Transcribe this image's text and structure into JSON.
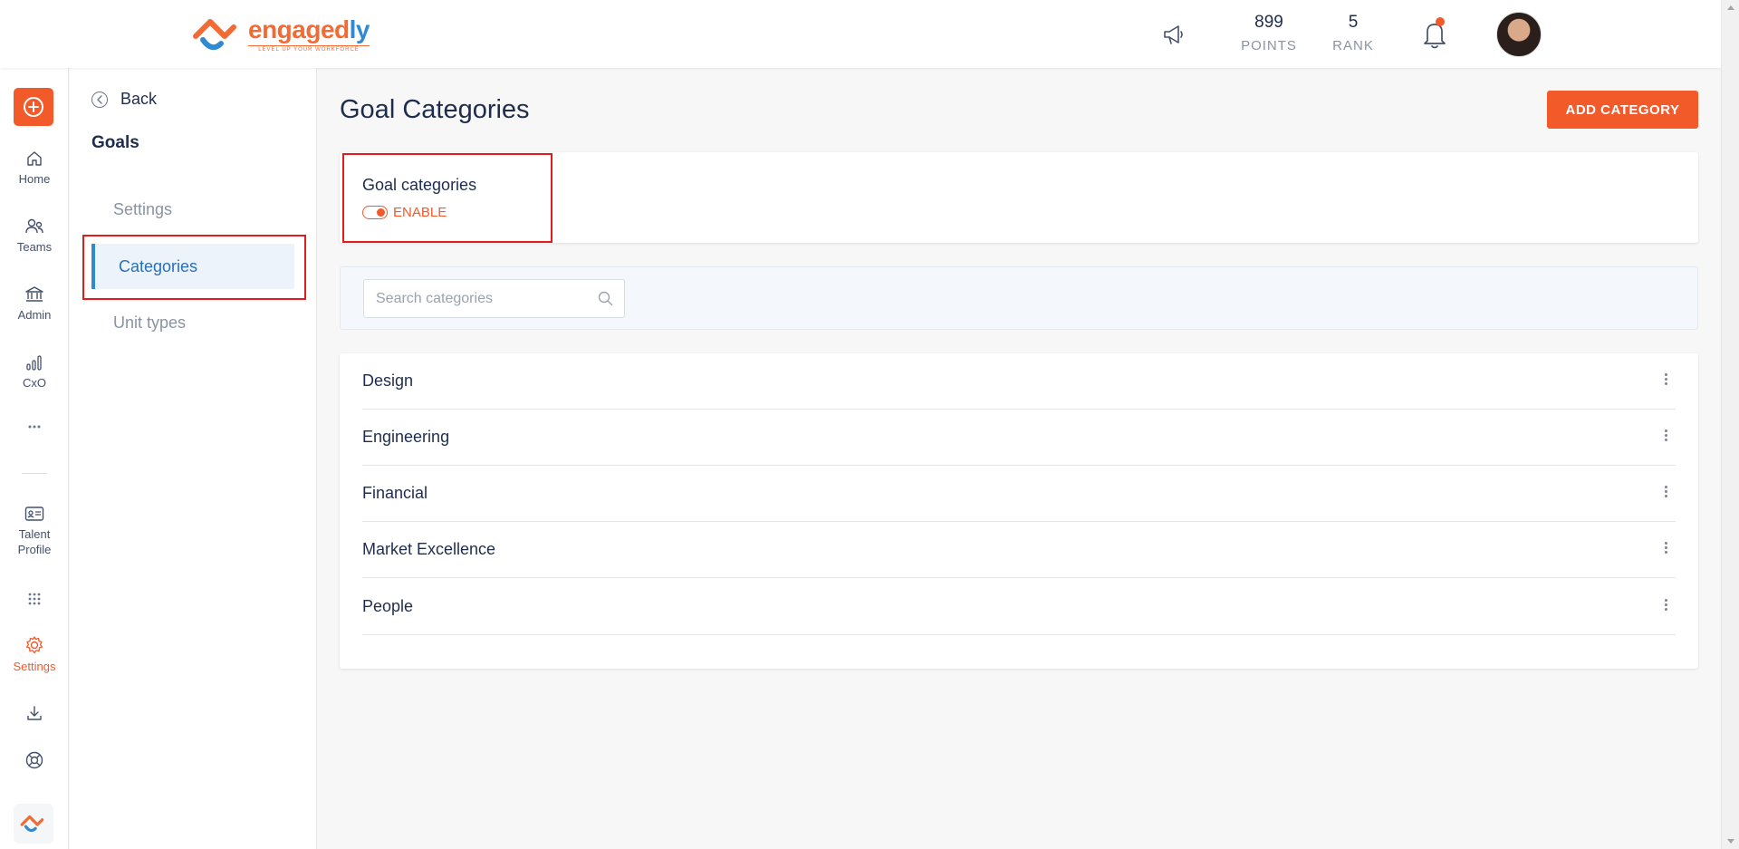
{
  "brand": {
    "name_part1": "engaged",
    "name_part2": "ly",
    "tagline": "LEVEL UP YOUR WORKFORCE"
  },
  "header": {
    "points": {
      "value": "899",
      "label": "POINTS"
    },
    "rank": {
      "value": "5",
      "label": "RANK"
    }
  },
  "rail": {
    "items": [
      {
        "label": "Home"
      },
      {
        "label": "Teams"
      },
      {
        "label": "Admin"
      },
      {
        "label": "CxO"
      },
      {
        "label": "Talent Profile"
      },
      {
        "label": "Settings"
      }
    ]
  },
  "subnav": {
    "back_label": "Back",
    "title": "Goals",
    "items": [
      {
        "label": "Settings"
      },
      {
        "label": "Categories"
      },
      {
        "label": "Unit types"
      }
    ]
  },
  "main": {
    "title": "Goal Categories",
    "add_button": "ADD CATEGORY",
    "toggle": {
      "label": "Goal categories",
      "state_text": "ENABLE"
    },
    "search": {
      "placeholder": "Search categories",
      "value": ""
    },
    "categories": [
      {
        "name": "Design"
      },
      {
        "name": "Engineering"
      },
      {
        "name": "Financial"
      },
      {
        "name": "Market Excellence"
      },
      {
        "name": "People"
      }
    ]
  },
  "colors": {
    "accent": "#f25a2a",
    "brand_blue": "#2f8ad1",
    "text": "#1f2d4d",
    "highlight": "#e21b1b"
  }
}
